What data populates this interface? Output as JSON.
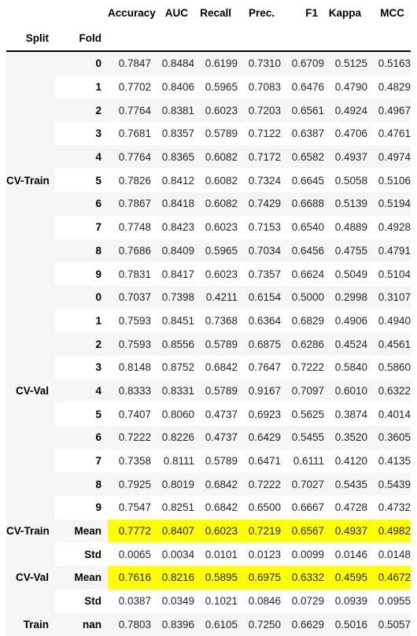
{
  "table": {
    "index_headers": [
      "Split",
      "Fold"
    ],
    "columns": [
      "Accuracy",
      "AUC",
      "Recall",
      "Prec.",
      "F1",
      "Kappa",
      "MCC"
    ],
    "highlight_color": "#ffff00",
    "stripe_color": "#f5f5f5",
    "index_bg_color": "#f5f5f5",
    "rows": [
      {
        "split": "",
        "fold": "0",
        "values": [
          "0.7847",
          "0.8484",
          "0.6199",
          "0.7310",
          "0.6709",
          "0.5125",
          "0.5163"
        ],
        "highlight": false
      },
      {
        "split": "",
        "fold": "1",
        "values": [
          "0.7702",
          "0.8406",
          "0.5965",
          "0.7083",
          "0.6476",
          "0.4790",
          "0.4829"
        ],
        "highlight": false
      },
      {
        "split": "",
        "fold": "2",
        "values": [
          "0.7764",
          "0.8381",
          "0.6023",
          "0.7203",
          "0.6561",
          "0.4924",
          "0.4967"
        ],
        "highlight": false
      },
      {
        "split": "",
        "fold": "3",
        "values": [
          "0.7681",
          "0.8357",
          "0.5789",
          "0.7122",
          "0.6387",
          "0.4706",
          "0.4761"
        ],
        "highlight": false
      },
      {
        "split": "",
        "fold": "4",
        "values": [
          "0.7764",
          "0.8365",
          "0.6082",
          "0.7172",
          "0.6582",
          "0.4937",
          "0.4974"
        ],
        "highlight": false
      },
      {
        "split": "CV-Train",
        "fold": "5",
        "values": [
          "0.7826",
          "0.8412",
          "0.6082",
          "0.7324",
          "0.6645",
          "0.5058",
          "0.5106"
        ],
        "highlight": false
      },
      {
        "split": "",
        "fold": "6",
        "values": [
          "0.7867",
          "0.8418",
          "0.6082",
          "0.7429",
          "0.6688",
          "0.5139",
          "0.5194"
        ],
        "highlight": false
      },
      {
        "split": "",
        "fold": "7",
        "values": [
          "0.7748",
          "0.8423",
          "0.6023",
          "0.7153",
          "0.6540",
          "0.4889",
          "0.4928"
        ],
        "highlight": false
      },
      {
        "split": "",
        "fold": "8",
        "values": [
          "0.7686",
          "0.8409",
          "0.5965",
          "0.7034",
          "0.6456",
          "0.4755",
          "0.4791"
        ],
        "highlight": false
      },
      {
        "split": "",
        "fold": "9",
        "values": [
          "0.7831",
          "0.8417",
          "0.6023",
          "0.7357",
          "0.6624",
          "0.5049",
          "0.5104"
        ],
        "highlight": false
      },
      {
        "split": "",
        "fold": "0",
        "values": [
          "0.7037",
          "0.7398",
          "0.4211",
          "0.6154",
          "0.5000",
          "0.2998",
          "0.3107"
        ],
        "highlight": false
      },
      {
        "split": "",
        "fold": "1",
        "values": [
          "0.7593",
          "0.8451",
          "0.7368",
          "0.6364",
          "0.6829",
          "0.4906",
          "0.4940"
        ],
        "highlight": false
      },
      {
        "split": "",
        "fold": "2",
        "values": [
          "0.7593",
          "0.8556",
          "0.5789",
          "0.6875",
          "0.6286",
          "0.4524",
          "0.4561"
        ],
        "highlight": false
      },
      {
        "split": "",
        "fold": "3",
        "values": [
          "0.8148",
          "0.8752",
          "0.6842",
          "0.7647",
          "0.7222",
          "0.5840",
          "0.5860"
        ],
        "highlight": false
      },
      {
        "split": "CV-Val",
        "fold": "4",
        "values": [
          "0.8333",
          "0.8331",
          "0.5789",
          "0.9167",
          "0.7097",
          "0.6010",
          "0.6322"
        ],
        "highlight": false
      },
      {
        "split": "",
        "fold": "5",
        "values": [
          "0.7407",
          "0.8060",
          "0.4737",
          "0.6923",
          "0.5625",
          "0.3874",
          "0.4014"
        ],
        "highlight": false
      },
      {
        "split": "",
        "fold": "6",
        "values": [
          "0.7222",
          "0.8226",
          "0.4737",
          "0.6429",
          "0.5455",
          "0.3520",
          "0.3605"
        ],
        "highlight": false
      },
      {
        "split": "",
        "fold": "7",
        "values": [
          "0.7358",
          "0.8111",
          "0.5789",
          "0.6471",
          "0.6111",
          "0.4120",
          "0.4135"
        ],
        "highlight": false
      },
      {
        "split": "",
        "fold": "8",
        "values": [
          "0.7925",
          "0.8019",
          "0.6842",
          "0.7222",
          "0.7027",
          "0.5435",
          "0.5439"
        ],
        "highlight": false
      },
      {
        "split": "",
        "fold": "9",
        "values": [
          "0.7547",
          "0.8251",
          "0.6842",
          "0.6500",
          "0.6667",
          "0.4728",
          "0.4732"
        ],
        "highlight": false
      },
      {
        "split": "CV-Train",
        "fold": "Mean",
        "values": [
          "0.7772",
          "0.8407",
          "0.6023",
          "0.7219",
          "0.6567",
          "0.4937",
          "0.4982"
        ],
        "highlight": true
      },
      {
        "split": "",
        "fold": "Std",
        "values": [
          "0.0065",
          "0.0034",
          "0.0101",
          "0.0123",
          "0.0099",
          "0.0146",
          "0.0148"
        ],
        "highlight": false
      },
      {
        "split": "CV-Val",
        "fold": "Mean",
        "values": [
          "0.7616",
          "0.8216",
          "0.5895",
          "0.6975",
          "0.6332",
          "0.4595",
          "0.4672"
        ],
        "highlight": true
      },
      {
        "split": "",
        "fold": "Std",
        "values": [
          "0.0387",
          "0.0349",
          "0.1021",
          "0.0846",
          "0.0729",
          "0.0939",
          "0.0955"
        ],
        "highlight": false
      },
      {
        "split": "Train",
        "fold": "nan",
        "values": [
          "0.7803",
          "0.8396",
          "0.6105",
          "0.7250",
          "0.6629",
          "0.5016",
          "0.5057"
        ],
        "highlight": false
      }
    ]
  }
}
